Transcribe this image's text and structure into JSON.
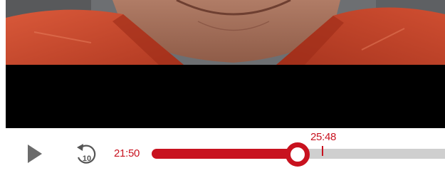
{
  "player": {
    "current_time": "21:50",
    "hover_time": "25:48",
    "progress_fraction": 0.49,
    "hover_fraction": 0.58,
    "rewind_seconds": "10",
    "icons": {
      "play": "play-icon",
      "rewind": "rewind-10-icon"
    },
    "colors": {
      "accent": "#c8121f",
      "track": "#cfcfcf",
      "play_icon": "#6b6b6b",
      "background": "#ffffff",
      "video_bg": "#000000"
    }
  }
}
